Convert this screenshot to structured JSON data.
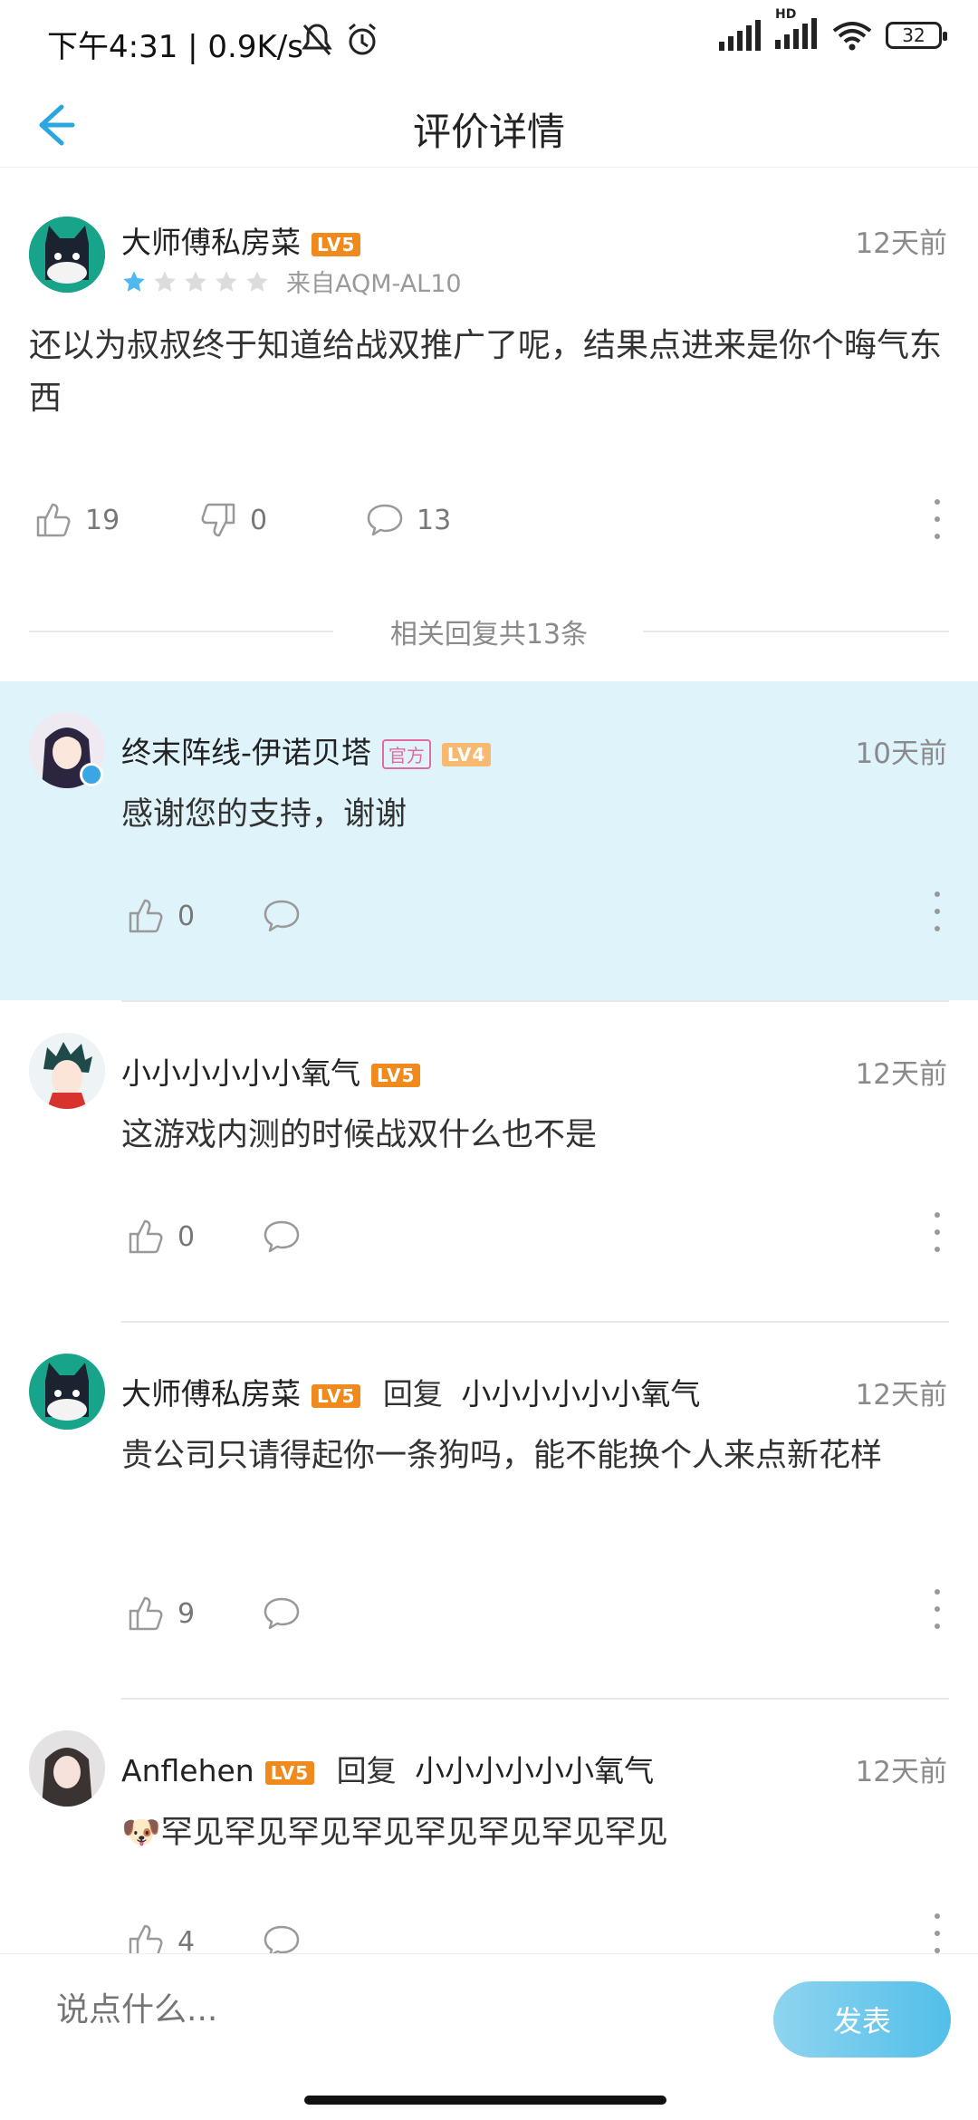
{
  "status_bar": {
    "time_speed": "下午4:31 | 0.9K/s",
    "hd_label": "HD",
    "battery": "32"
  },
  "header": {
    "title": "评价详情"
  },
  "review": {
    "username": "大师傅私房菜",
    "level": "LV5",
    "time": "12天前",
    "rating": 1,
    "rating_max": 5,
    "device": "来自AQM-AL10",
    "content": "还以为叔叔终于知道给战双推广了呢，结果点进来是你个晦气东西",
    "likes": "19",
    "dislikes": "0",
    "comments": "13"
  },
  "replies_section": {
    "label": "相关回复共13条"
  },
  "replies": [
    {
      "username": "终末阵线-伊诺贝塔",
      "official": "官方",
      "level": "LV4",
      "time": "10天前",
      "content": "感谢您的支持，谢谢",
      "likes": "0",
      "highlighted": true
    },
    {
      "username": "小小小小小小氧气",
      "level": "LV5",
      "time": "12天前",
      "content": "这游戏内测的时候战双什么也不是",
      "likes": "0"
    },
    {
      "username": "大师傅私房菜",
      "level": "LV5",
      "reply_word": "回复",
      "reply_to": "小小小小小小氧气",
      "time": "12天前",
      "content": "贵公司只请得起你一条狗吗，能不能换个人来点新花样",
      "likes": "9"
    },
    {
      "username": "Anflehen",
      "level": "LV5",
      "reply_word": "回复",
      "reply_to": "小小小小小小氧气",
      "time": "12天前",
      "emoji": "🐶",
      "content": "罕见罕见罕见罕见罕见罕见罕见罕见",
      "likes": "4"
    }
  ],
  "bottom_bar": {
    "placeholder": "说点什么...",
    "submit_label": "发表"
  },
  "colors": {
    "accent": "#2aa6e0",
    "highlight_bg": "#dff3fb",
    "level_badge": "#f08a1c",
    "official_badge": "#e26aa2",
    "star_active": "#4fb8ee",
    "star_inactive": "#dcdcdc"
  }
}
